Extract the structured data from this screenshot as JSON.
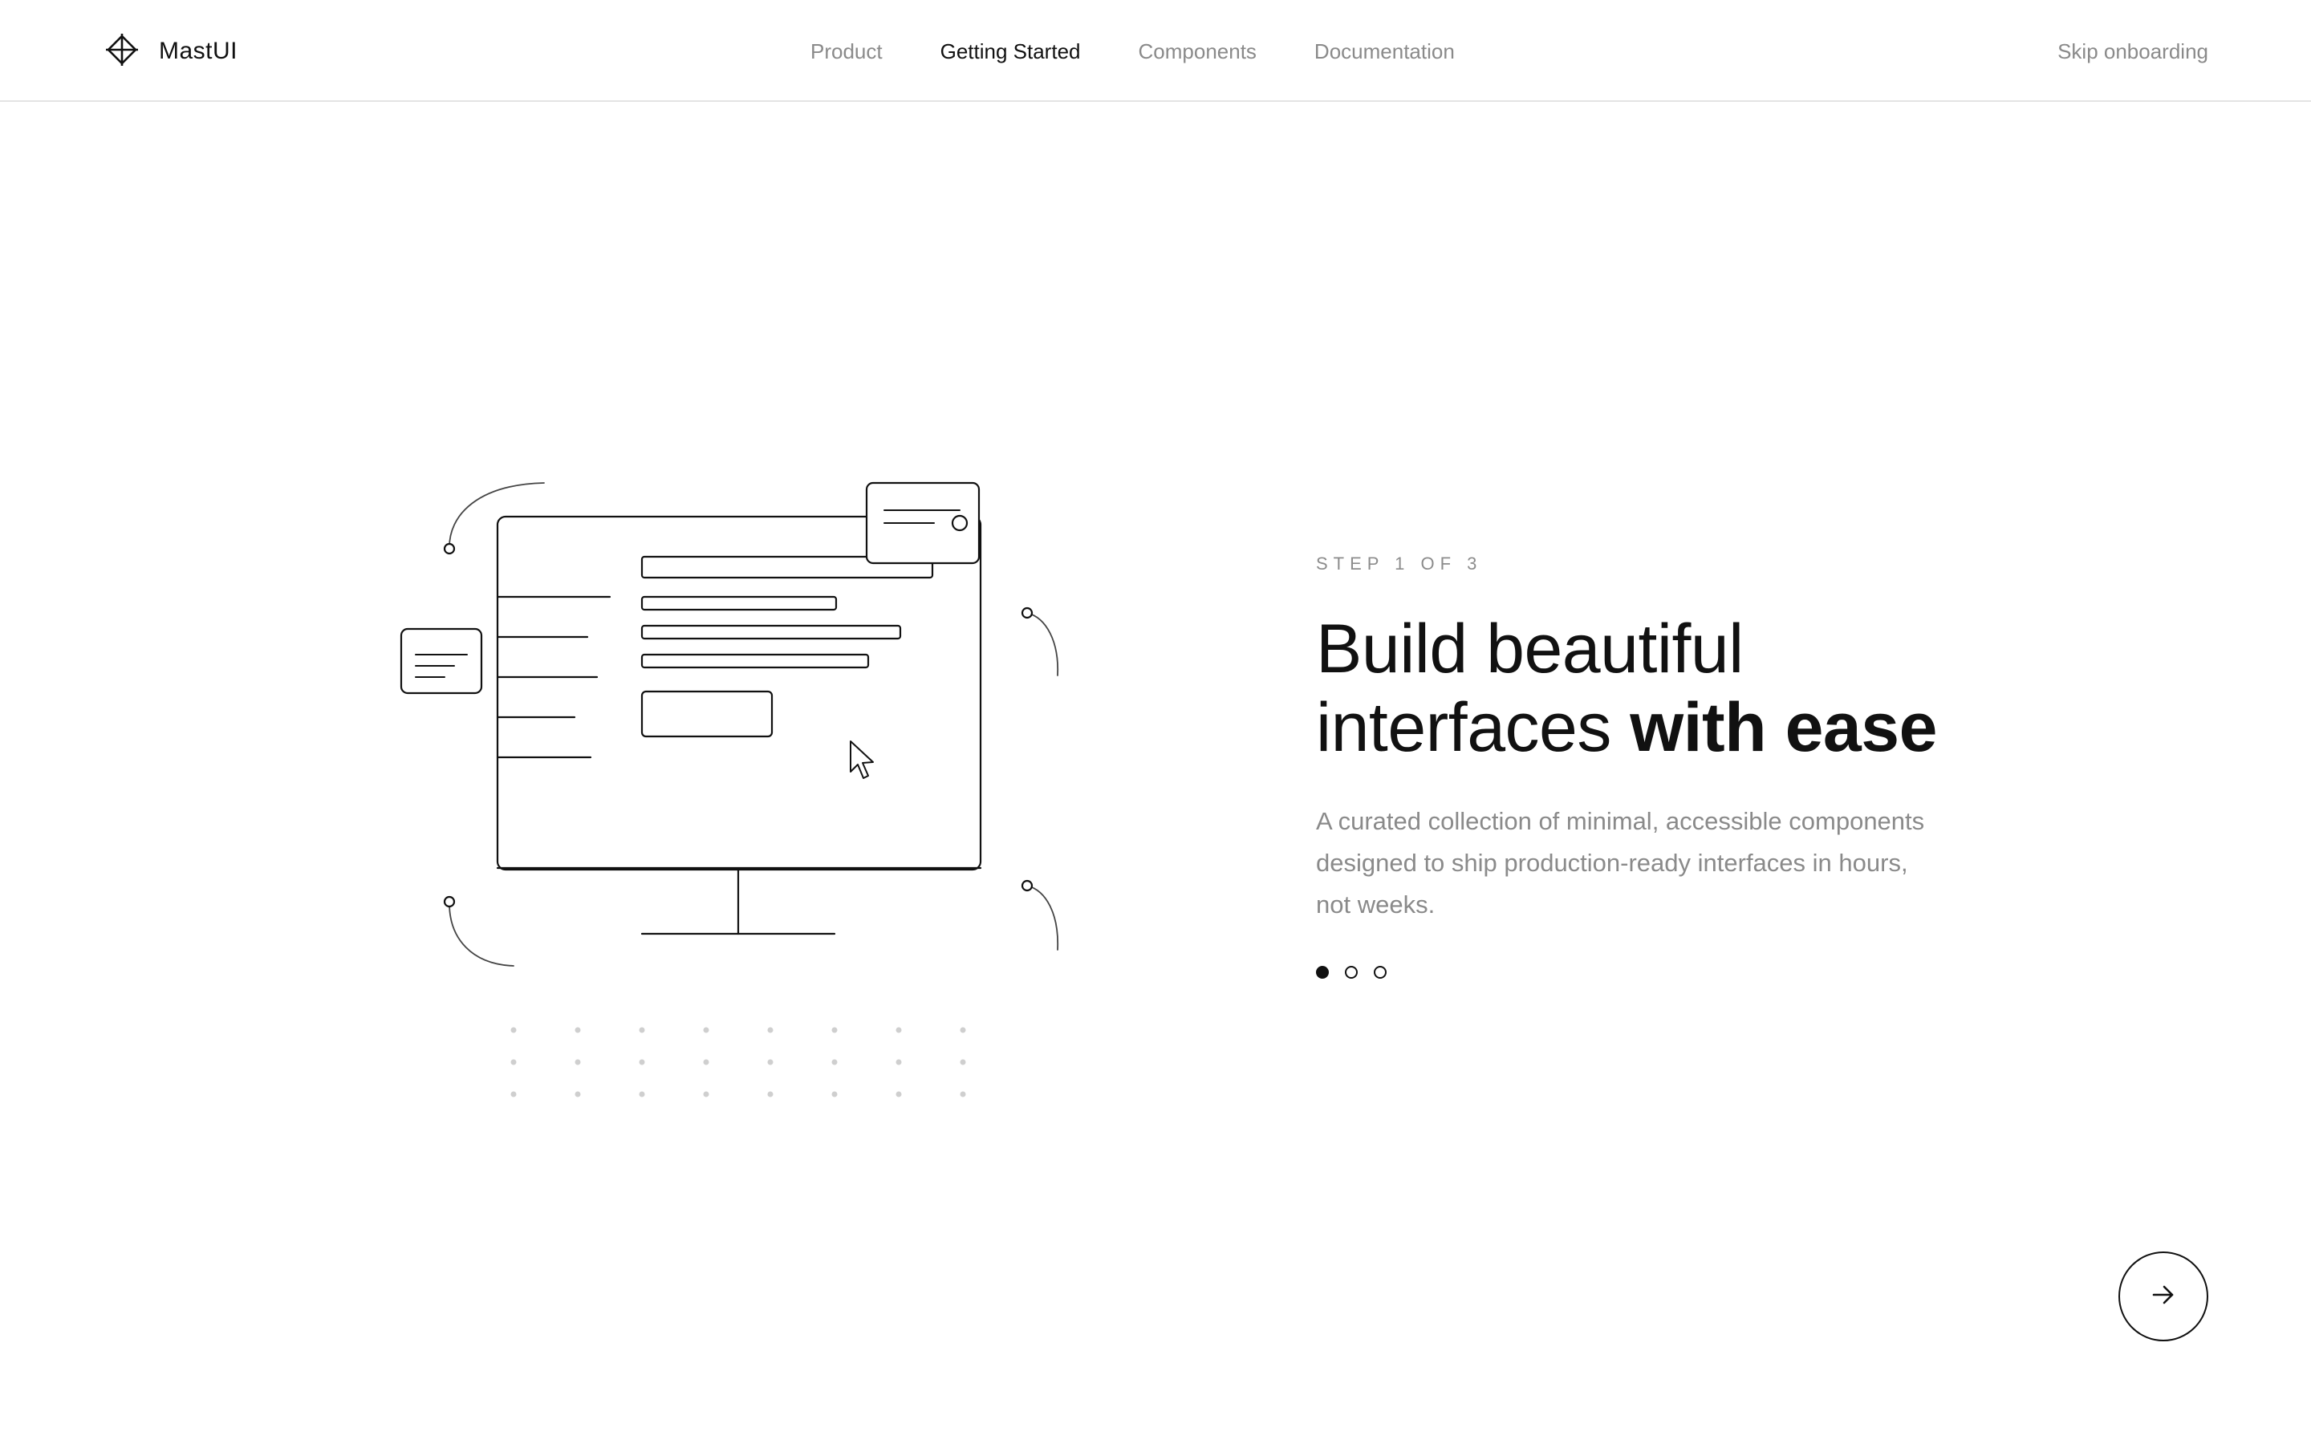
{
  "app": {
    "name": "MastUI",
    "logo_icon": "crosshair-diamond-icon"
  },
  "nav": {
    "items": [
      {
        "label": "Product",
        "active": false
      },
      {
        "label": "Getting Started",
        "active": true
      },
      {
        "label": "Components",
        "active": false
      },
      {
        "label": "Documentation",
        "active": false
      }
    ],
    "skip_label": "Skip onboarding"
  },
  "onboarding": {
    "step_label": "STEP 1 OF 3",
    "headline_regular": "Build beautiful interfaces ",
    "headline_bold": "with ease",
    "description": "A curated collection of minimal, accessible components designed to ship production-ready interfaces in hours, not weeks.",
    "current_step": 1,
    "total_steps": 3,
    "next_icon": "arrow-right-icon"
  },
  "illustration": {
    "icon": "desktop-monitor-illustration",
    "cursor_icon": "mouse-pointer-icon"
  },
  "colors": {
    "text": "#111111",
    "muted": "#8a8a8a",
    "border": "#e4e4e4",
    "background": "#ffffff"
  }
}
